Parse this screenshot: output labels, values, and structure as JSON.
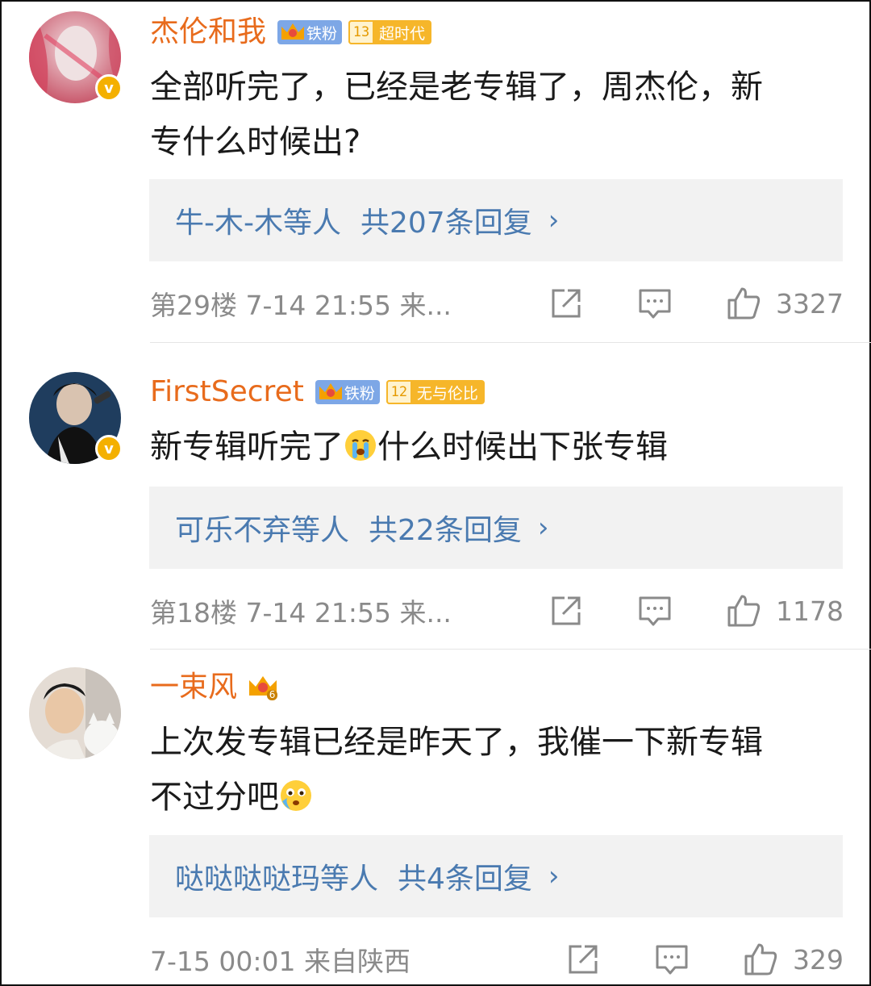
{
  "comments": [
    {
      "username": "杰伦和我",
      "badges": {
        "fan": "铁粉",
        "level": "13",
        "level_text": "超时代"
      },
      "text_lines": [
        "全部听完了，已经是老专辑了，周杰伦，新",
        "专什么时候出?"
      ],
      "reply_names": "牛-木-木等人",
      "reply_count": "共207条回复",
      "meta": "第29楼 7-14 21:55 来...",
      "likes": "3327",
      "verified": true
    },
    {
      "username": "FirstSecret",
      "badges": {
        "fan": "铁粉",
        "level": "12",
        "level_text": "无与伦比"
      },
      "text_before": "新专辑听完了",
      "text_after": "什么时候出下张专辑",
      "emoji_name": "crying-face",
      "reply_names": "可乐不弃等人",
      "reply_count": "共22条回复",
      "meta": "第18楼 7-14 21:55 来...",
      "likes": "1178",
      "verified": true
    },
    {
      "username": "一束风",
      "badges": {
        "crown_level": "6"
      },
      "text_lines": [
        "上次发专辑已经是昨天了，我催一下新专辑",
        "不过分吧"
      ],
      "emoji_name": "teary-scared-face",
      "reply_names": "哒哒哒哒玛等人",
      "reply_count": "共4条回复",
      "meta": "7-15 00:01 来自陕西",
      "likes": "329",
      "verified": false
    }
  ],
  "icons": {
    "share": "share-icon",
    "comment": "comment-icon",
    "like": "like-icon",
    "verified": "verified-badge-icon"
  },
  "colors": {
    "username": "#e86b1c",
    "reply_link": "#4a7ab0",
    "meta": "#8a8a8a",
    "reply_bg": "#f2f2f2",
    "verified": "#f4b000"
  }
}
